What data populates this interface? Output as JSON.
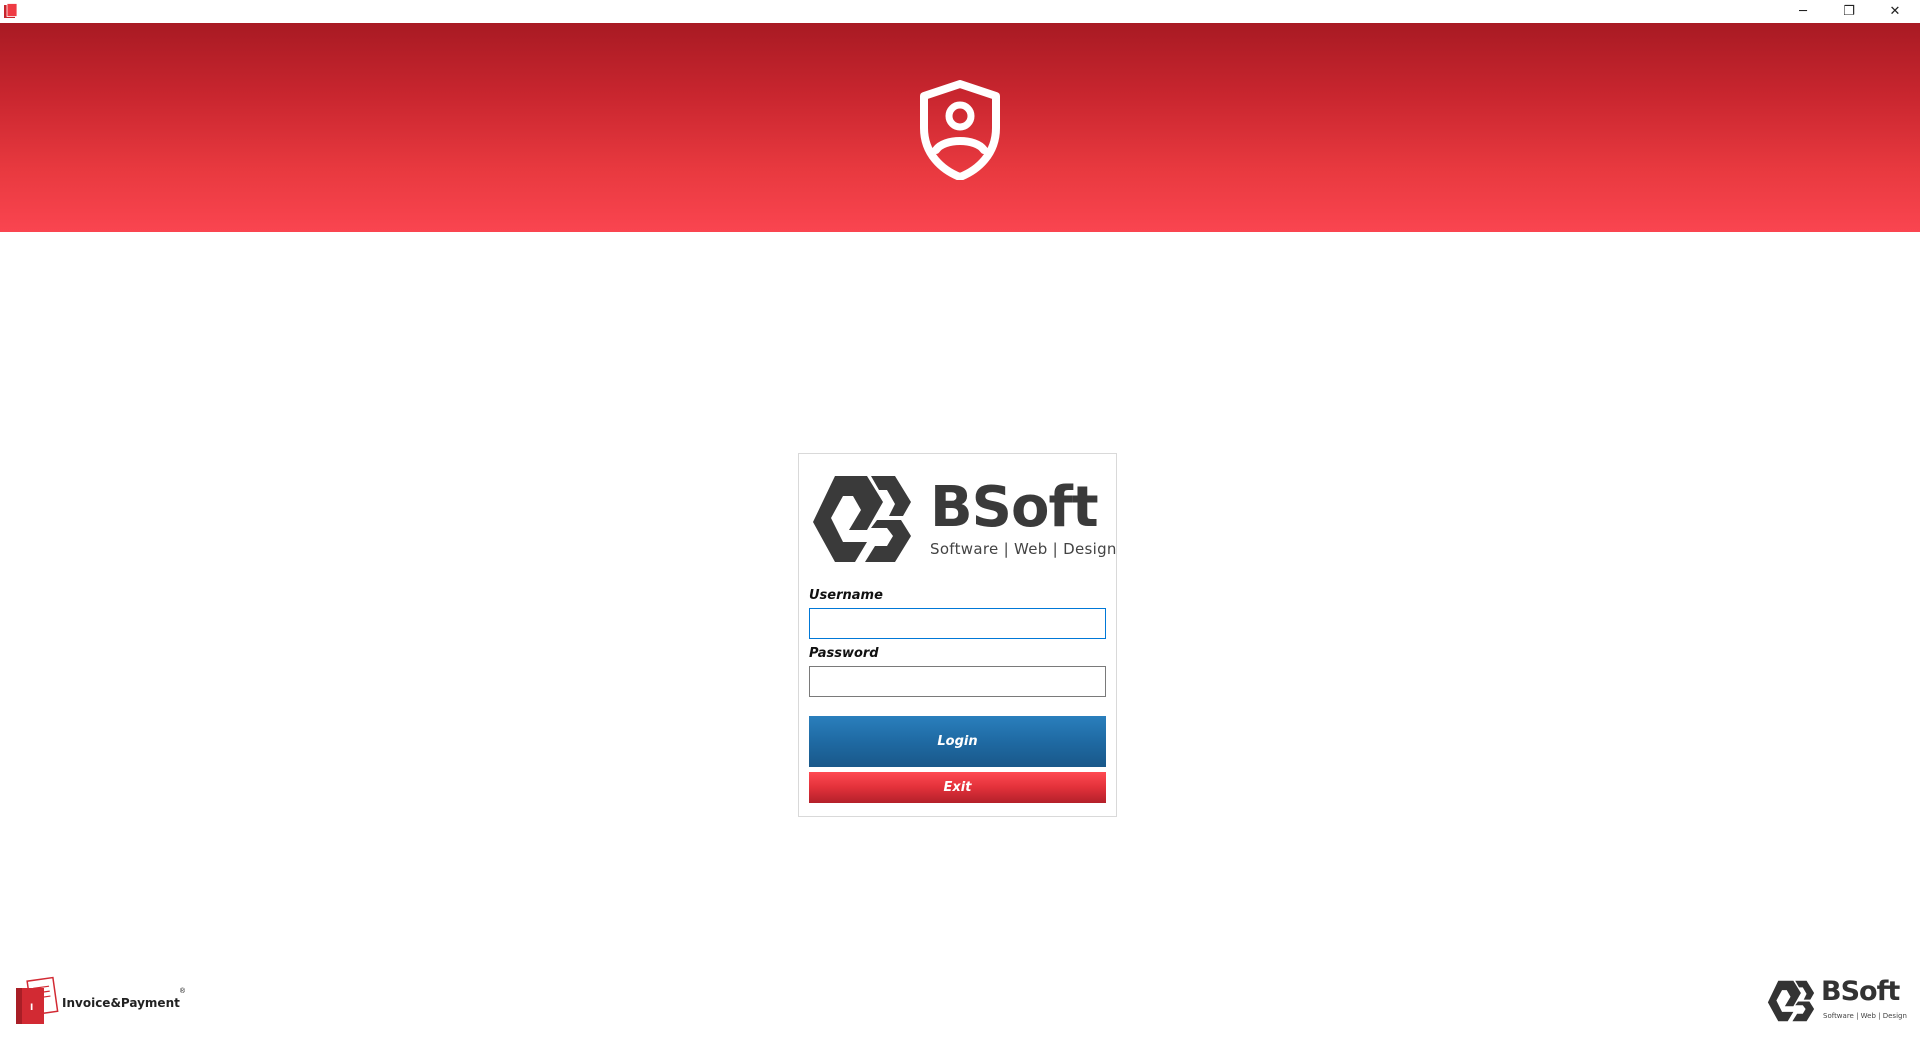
{
  "window": {
    "minimize_glyph": "─",
    "restore_glyph": "❐",
    "close_glyph": "✕",
    "app_icon": "invoice-payment-app-icon"
  },
  "banner": {
    "icon": "shield-user-icon",
    "gradient_top": "#a81a23",
    "gradient_bottom": "#fa4550"
  },
  "login": {
    "brand_name": "BSoft",
    "brand_tagline": "Software | Web | Design",
    "username_label": "Username",
    "username_value": "",
    "password_label": "Password",
    "password_value": "",
    "login_label": "Login",
    "exit_label": "Exit",
    "login_color": "#1f6aa3",
    "exit_color": "#e2313a"
  },
  "footer": {
    "product_name": "Invoice&Payment",
    "product_reg": "®",
    "company_name": "BSoft",
    "company_tagline": "Software | Web | Design"
  }
}
